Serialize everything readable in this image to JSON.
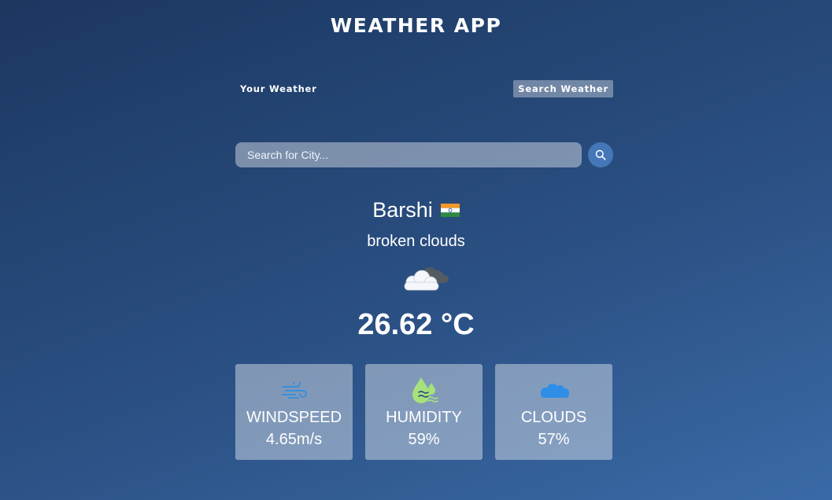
{
  "header": {
    "title": "WEATHER APP"
  },
  "tabs": [
    {
      "label": "Your Weather",
      "active": false
    },
    {
      "label": "Search Weather",
      "active": true
    }
  ],
  "search": {
    "placeholder": "Search for City...",
    "value": "",
    "button_icon": "search-icon"
  },
  "location": {
    "city": "Barshi",
    "country_flag": "india-flag"
  },
  "weather": {
    "description": "broken clouds",
    "icon": "broken-clouds-icon",
    "temperature": "26.62 °C"
  },
  "stats": [
    {
      "label": "WINDSPEED",
      "value": "4.65m/s",
      "icon": "wind-icon"
    },
    {
      "label": "HUMIDITY",
      "value": "59%",
      "icon": "humidity-icon"
    },
    {
      "label": "CLOUDS",
      "value": "57%",
      "icon": "cloud-icon"
    }
  ],
  "colors": {
    "background_start": "#1c3760",
    "background_end": "#3a6aa6",
    "search_button": "#4577b8",
    "wind_icon": "#3a8fd8",
    "humidity_icon": "#a6e17b",
    "cloud_icon": "#2f8fe6"
  }
}
